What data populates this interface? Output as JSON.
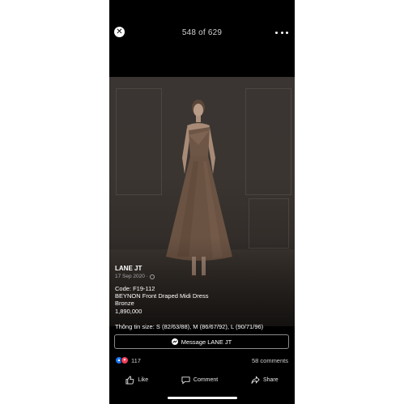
{
  "viewer": {
    "counter": "548 of 629",
    "close_icon": "close-icon",
    "more_icon": "more-dots-icon"
  },
  "post": {
    "page_name": "LANE JT",
    "date": "17 Sep 2020 ·",
    "privacy_icon": "globe-icon",
    "description": [
      "Code: F19-112",
      "BEYNON Front Draped Midi Dress",
      "Bronze",
      "1,890,000"
    ],
    "sizes": "Thông tin size: S (82/63/88), M (86/67/92), L (90/71/96)",
    "message_button": "Message LANE JT",
    "reactions_count": "117",
    "comments": "58 comments"
  },
  "actions": {
    "like": "Like",
    "comment": "Comment",
    "share": "Share"
  },
  "colors": {
    "background": "#000000",
    "like_blue": "#1877f2",
    "love_red": "#f33e58",
    "dress_bronze": "#6e5646"
  }
}
